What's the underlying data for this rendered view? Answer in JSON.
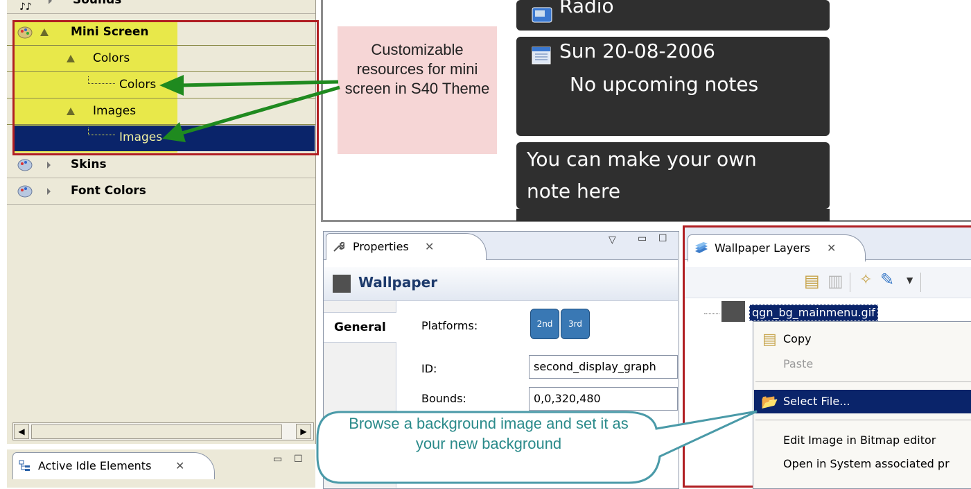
{
  "tree": {
    "items": [
      {
        "label": "Sounds",
        "bold": true
      },
      {
        "label": "Mini Screen",
        "bold": true
      },
      {
        "label": "Colors",
        "bold": false
      },
      {
        "label": "Colors",
        "bold": false
      },
      {
        "label": "Images",
        "bold": false
      },
      {
        "label": "Images",
        "bold": false
      },
      {
        "label": "Skins",
        "bold": true
      },
      {
        "label": "Font Colors",
        "bold": true
      }
    ]
  },
  "annotation": {
    "note_text": "Customizable resources for mini screen in S40 Theme",
    "callout_text": "Browse a background image and set it as your new background"
  },
  "preview": {
    "radio_label": "Radio",
    "date_line": "Sun 20-08-2006",
    "notes_line": "No upcoming notes",
    "own_note": "You can make your own note here"
  },
  "bottom_tab": {
    "label": "Active Idle Elements"
  },
  "properties": {
    "tab_label": "Properties",
    "header_title": "Wallpaper",
    "section_tab": "General",
    "platforms_label": "Platforms:",
    "platforms": [
      "2nd",
      "3rd"
    ],
    "id_label": "ID:",
    "id_value": "second_display_graph",
    "bounds_label": "Bounds:",
    "bounds_value": "0,0,320,480"
  },
  "layers": {
    "tab_label": "Wallpaper Layers",
    "file_name": "qgn_bg_mainmenu.gif",
    "menu": [
      "Copy",
      "Paste",
      "Select File...",
      "Edit Image in Bitmap editor",
      "Open in System associated pr"
    ]
  },
  "colors": {
    "highlight_yellow": "#e8e84a",
    "selection_navy": "#0a246a",
    "annotation_red": "#b01e22",
    "arrow_green": "#1f8a1f",
    "callout_text": "#2a8a8a",
    "note_bg": "#f6d6d6",
    "preview_dark": "#2f2f2f"
  }
}
